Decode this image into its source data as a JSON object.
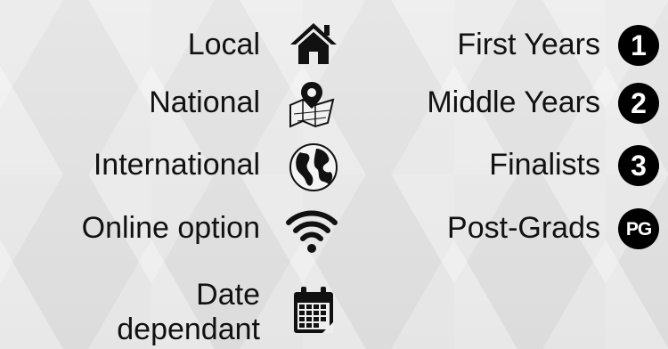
{
  "location_items": [
    {
      "label": "Local",
      "icon": "home-icon"
    },
    {
      "label": "National",
      "icon": "map-pin-icon"
    },
    {
      "label": "International",
      "icon": "globe-icon"
    },
    {
      "label": "Online option",
      "icon": "wifi-icon"
    },
    {
      "label_line1": "Date",
      "label_line2": "dependant",
      "icon": "calendar-icon"
    }
  ],
  "year_items": [
    {
      "label": "First Years",
      "badge": "1"
    },
    {
      "label": "Middle Years",
      "badge": "2"
    },
    {
      "label": "Finalists",
      "badge": "3"
    },
    {
      "label": "Post-Grads",
      "badge": "PG"
    }
  ],
  "colors": {
    "text": "#111111",
    "badge_bg": "#000000",
    "badge_text": "#ffffff"
  }
}
